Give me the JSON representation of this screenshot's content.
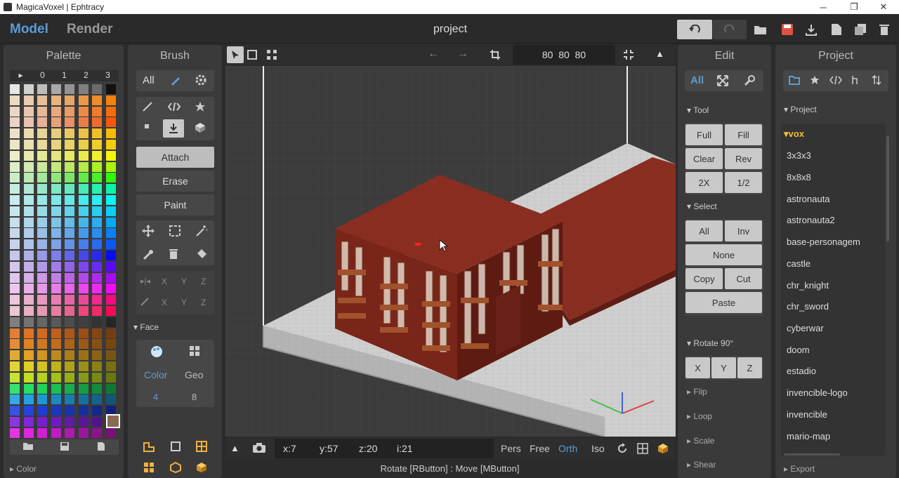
{
  "window": {
    "title": "MagicaVoxel | Ephtracy",
    "minimize": "─",
    "maximize": "❐",
    "close": "✕"
  },
  "topbar": {
    "mode_model": "Model",
    "mode_render": "Render",
    "project_name": "project"
  },
  "palette": {
    "title": "Palette",
    "tabs": [
      "▸",
      "0",
      "1",
      "2",
      "3"
    ],
    "footer": "Color"
  },
  "brush": {
    "title": "Brush",
    "filter_all": "All",
    "modes": [
      "Attach",
      "Erase",
      "Paint"
    ],
    "axes1": [
      "X",
      "Y",
      "Z"
    ],
    "axes2": [
      "X",
      "Y",
      "Z"
    ],
    "face_section": "Face",
    "face_color_label": "Color",
    "face_geo_label": "Geo",
    "face_color_value": "4",
    "face_geo_value": "8"
  },
  "viewport": {
    "dimensions": "80  80  80",
    "coords": {
      "x": "x:7",
      "y": "y:57",
      "z": "z:20",
      "i": "i:21"
    },
    "views": [
      "Pers",
      "Free",
      "Orth",
      "Iso"
    ],
    "active_view": "Orth",
    "status": "Rotate [RButton] : Move [MButton]"
  },
  "edit": {
    "title": "Edit",
    "filter_all": "All",
    "tool_section": "Tool",
    "tool_buttons": [
      "Full",
      "Fill",
      "Clear",
      "Rev",
      "2X",
      "1/2"
    ],
    "select_section": "Select",
    "select_buttons": [
      "All",
      "Inv"
    ],
    "select_none": "None",
    "copy_cut": [
      "Copy",
      "Cut"
    ],
    "paste": "Paste",
    "rotate_section": "Rotate 90°",
    "rotate_axes": [
      "X",
      "Y",
      "Z"
    ],
    "collapsed_sections": [
      "Flip",
      "Loop",
      "Scale",
      "Shear"
    ]
  },
  "project": {
    "title": "Project",
    "section": "Project",
    "folder": "vox",
    "files": [
      "3x3x3",
      "8x8x8",
      "astronauta",
      "astronauta2",
      "base-personagem",
      "castle",
      "chr_knight",
      "chr_sword",
      "cyberwar",
      "doom",
      "estadio",
      "invencible-logo",
      "invencible",
      "mario-map"
    ],
    "export": "Export"
  },
  "colors": {
    "accent": "#5b9bd5",
    "save": "#e05040",
    "folder": "#f0c030",
    "brick": "#8b2e22"
  }
}
